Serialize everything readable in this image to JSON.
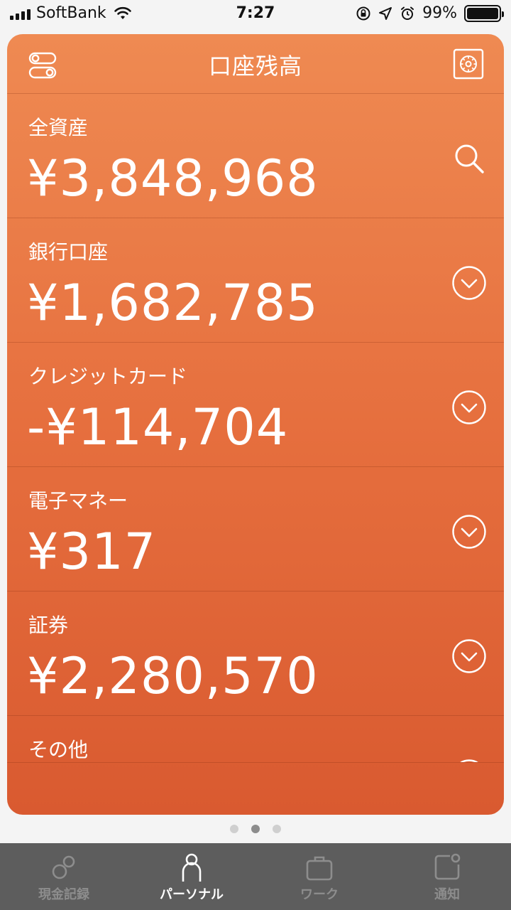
{
  "status_bar": {
    "carrier": "SoftBank",
    "time": "7:27",
    "battery": "99%"
  },
  "header": {
    "title": "口座残高"
  },
  "sections": [
    {
      "label": "全資産",
      "amount": "¥3,848,968",
      "action_icon": "search-icon"
    },
    {
      "label": "銀行口座",
      "amount": "¥1,682,785",
      "action_icon": "chevron-down-circle-icon"
    },
    {
      "label": "クレジットカード",
      "amount": "-¥114,704",
      "action_icon": "chevron-down-circle-icon"
    },
    {
      "label": "電子マネー",
      "amount": "¥317",
      "action_icon": "chevron-down-circle-icon"
    },
    {
      "label": "証券",
      "amount": "¥2,280,570",
      "action_icon": "chevron-down-circle-icon"
    },
    {
      "label": "その他",
      "amount": "",
      "action_icon": "chevron-down-circle-icon"
    }
  ],
  "page_dots": {
    "count": 3,
    "active_index": 1
  },
  "tab_bar": {
    "tabs": [
      {
        "label": "現金記録",
        "icon": "cash-record-icon",
        "active": false
      },
      {
        "label": "パーソナル",
        "icon": "person-icon",
        "active": true
      },
      {
        "label": "ワーク",
        "icon": "briefcase-icon",
        "active": false
      },
      {
        "label": "通知",
        "icon": "notification-icon",
        "active": false
      }
    ]
  },
  "colors": {
    "card_top": "#ef8a52",
    "card_bottom": "#d95a30",
    "tab_bar_bg": "#5d5d5d",
    "tab_active": "#ffffff",
    "tab_inactive": "#8d8d8d"
  }
}
